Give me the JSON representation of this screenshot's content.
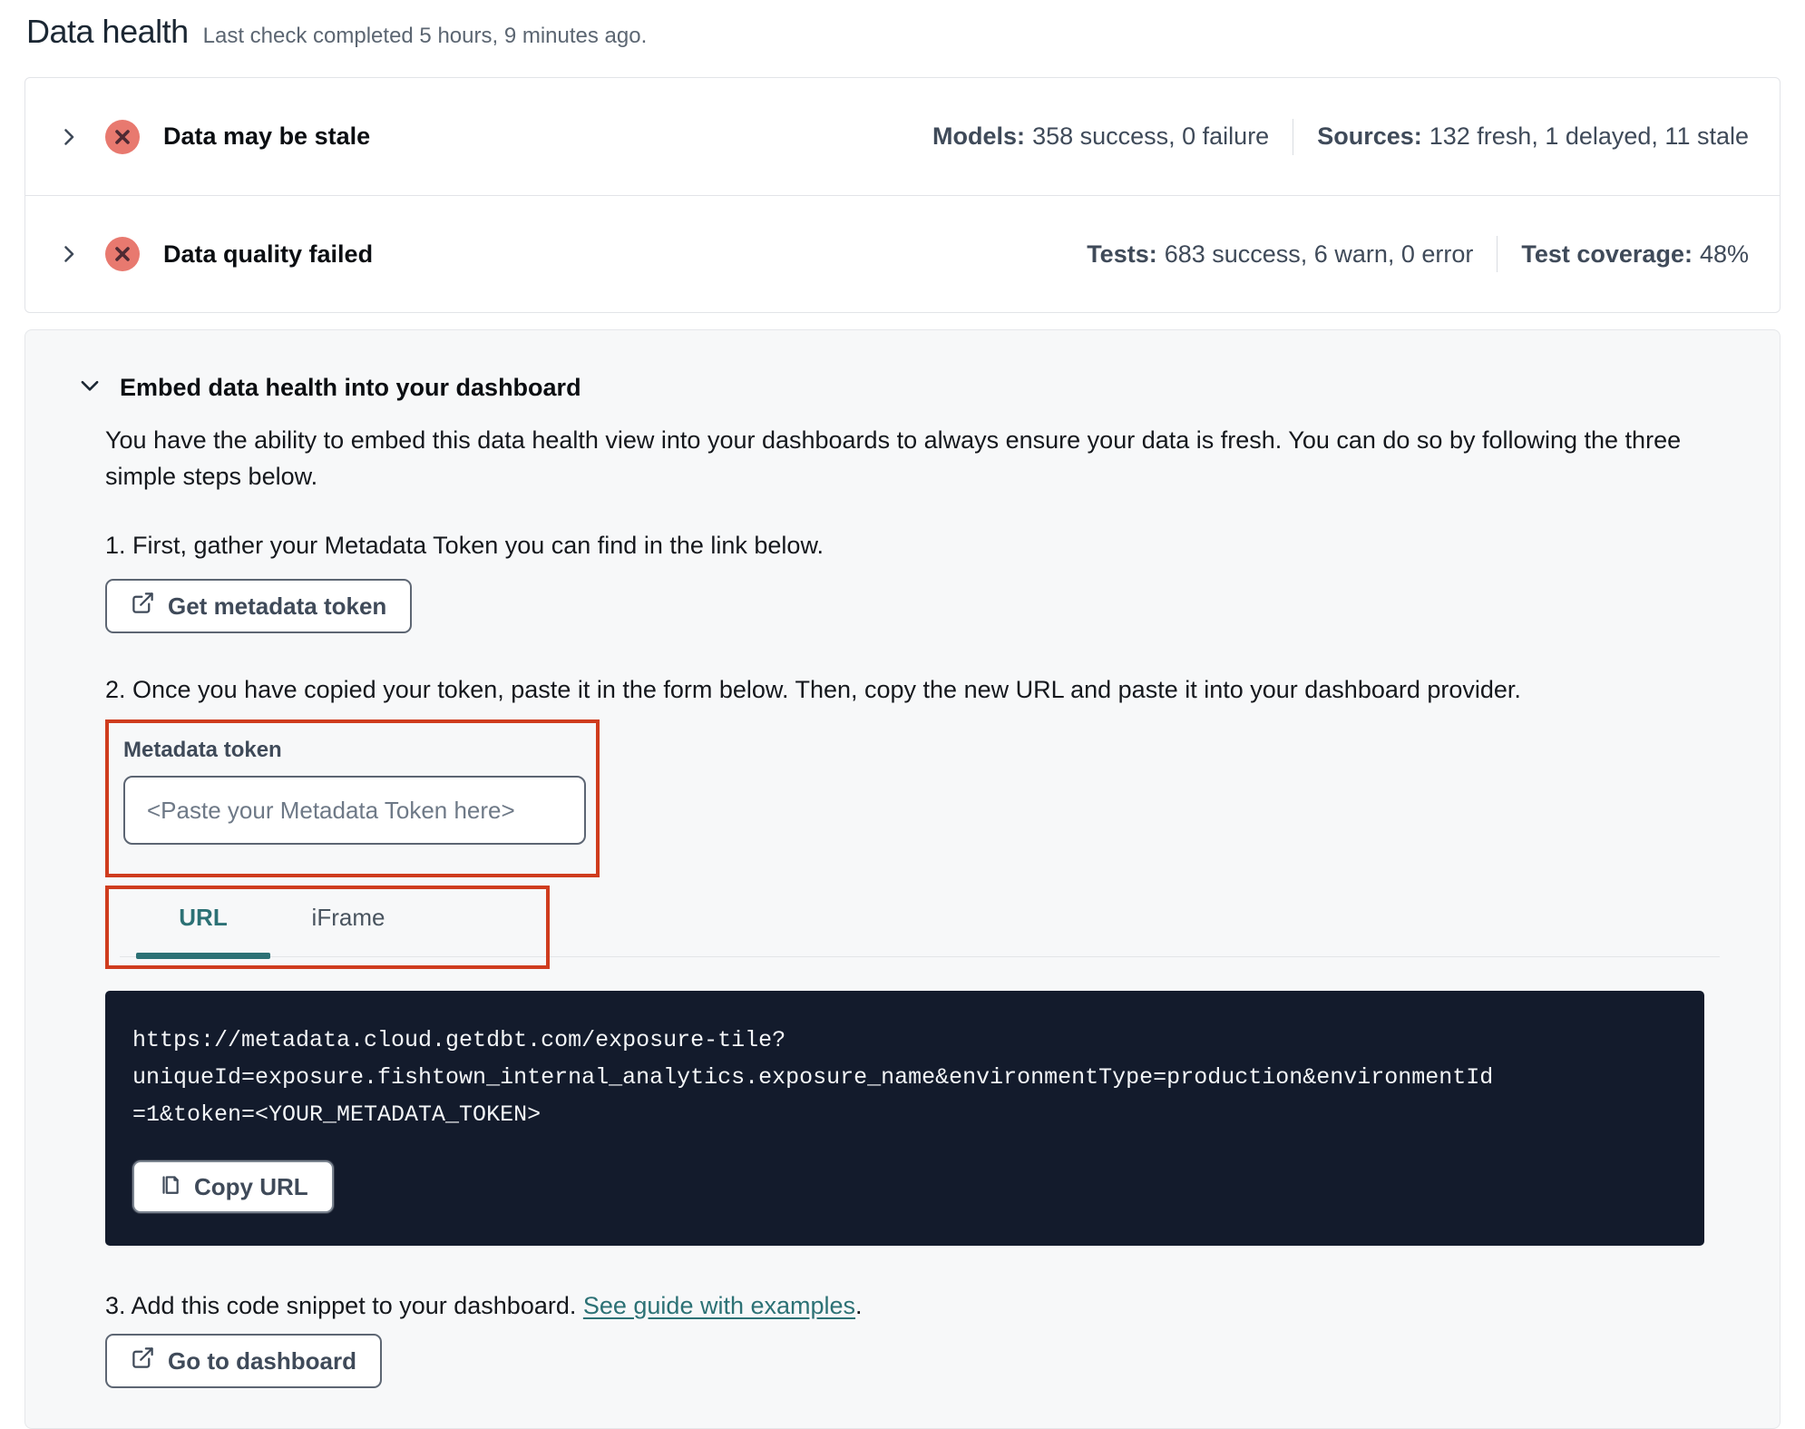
{
  "page": {
    "title": "Data health",
    "subtitle": "Last check completed 5 hours, 9 minutes ago."
  },
  "status_cards": [
    {
      "title": "Data may be stale",
      "status_icon": "x-circle-icon",
      "stats": [
        {
          "label": "Models:",
          "value": "358 success, 0 failure"
        },
        {
          "label": "Sources:",
          "value": "132 fresh, 1 delayed, 11 stale"
        }
      ]
    },
    {
      "title": "Data quality failed",
      "status_icon": "x-circle-icon",
      "stats": [
        {
          "label": "Tests:",
          "value": "683 success, 6 warn, 0 error"
        },
        {
          "label": "Test coverage:",
          "value": "48%"
        }
      ]
    }
  ],
  "embed": {
    "title": "Embed data health into your dashboard",
    "description": "You have the ability to embed this data health view into your dashboards to always ensure your data is fresh. You can do so by following the three simple steps below.",
    "step1": "1. First, gather your Metadata Token you can find in the link below.",
    "get_token_button": "Get metadata token",
    "step2": "2. Once you have copied your token, paste it in the form below. Then, copy the new URL and paste it into your dashboard provider.",
    "token_label": "Metadata token",
    "token_placeholder": "<Paste your Metadata Token here>",
    "token_value": "",
    "tabs": [
      {
        "label": "URL",
        "active": true
      },
      {
        "label": "iFrame",
        "active": false
      }
    ],
    "url_value": "https://metadata.cloud.getdbt.com/exposure-tile?uniqueId=exposure.fishtown_internal_analytics.exposure_name&environmentType=production&environmentId=1&token=<YOUR_METADATA_TOKEN>",
    "url_lines": [
      "https://metadata.cloud.getdbt.com/exposure-tile?",
      "uniqueId=exposure.fishtown_internal_analytics.exposure_name&environmentType=production&environmentId",
      "=1&token=<YOUR_METADATA_TOKEN>"
    ],
    "copy_button": "Copy URL",
    "step3_prefix": "3. Add this code snippet to your dashboard. ",
    "step3_link": "See guide with examples",
    "step3_suffix": "."
  },
  "dashboard_button": "Go to dashboard",
  "icons": {
    "collapse": "chevron-right-icon",
    "expand": "chevron-down-icon",
    "status_error": "x-circle-icon",
    "external": "external-link-icon",
    "copy": "copy-icon"
  },
  "colors": {
    "error_badge": "#e8796f",
    "error_badge_x": "#4e2a33",
    "teal_accent": "#2c7175",
    "annotation_red": "#cf3c1e",
    "code_background": "#131b2c",
    "panel_background": "#f7f8f9"
  }
}
